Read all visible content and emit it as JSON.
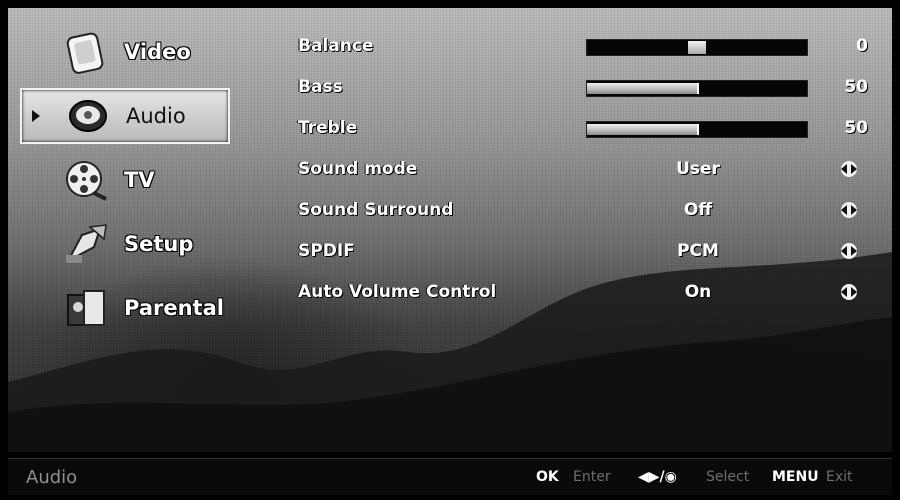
{
  "sidebar": {
    "items": [
      {
        "label": "Video",
        "icon": "video-icon"
      },
      {
        "label": "Audio",
        "icon": "audio-icon",
        "selected": true
      },
      {
        "label": "TV",
        "icon": "tv-reel-icon"
      },
      {
        "label": "Setup",
        "icon": "setup-icon"
      },
      {
        "label": "Parental",
        "icon": "parental-icon"
      }
    ]
  },
  "settings": {
    "balance": {
      "label": "Balance",
      "value": "0",
      "level": 0.5
    },
    "bass": {
      "label": "Bass",
      "value": "50",
      "level": 0.5
    },
    "treble": {
      "label": "Treble",
      "value": "50",
      "level": 0.5
    },
    "sound_mode": {
      "label": "Sound mode",
      "value": "User"
    },
    "sound_surround": {
      "label": "Sound Surround",
      "value": "Off"
    },
    "spdif": {
      "label": "SPDIF",
      "value": "PCM"
    },
    "auto_volume": {
      "label": "Auto Volume Control",
      "value": "On"
    }
  },
  "footer": {
    "title": "Audio",
    "ok_key": "OK",
    "ok_action": "Enter",
    "nav_key": "◀▶/◉",
    "nav_action": "Select",
    "menu_key": "MENU",
    "menu_action": "Exit"
  },
  "colors": {
    "selected_bg": "#d0d0d0",
    "text": "#ffffff",
    "footer_bg": "#0a0a0a"
  }
}
